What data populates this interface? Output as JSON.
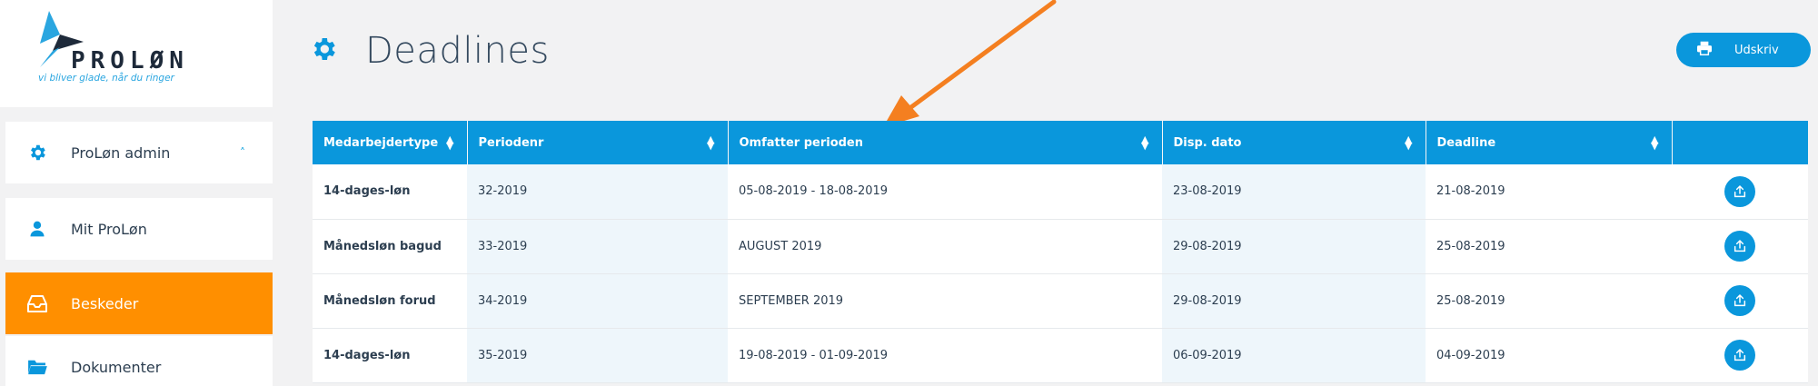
{
  "brand": {
    "name": "PROLØN",
    "tagline": "vi bliver glade, når du ringer",
    "accent": "#0a97dc",
    "highlight": "#ff8f00"
  },
  "sidebar": {
    "items": [
      {
        "label": "ProLøn admin",
        "icon": "gear-icon",
        "expanded": true
      },
      {
        "label": "Mit ProLøn",
        "icon": "user-icon"
      },
      {
        "label": "Beskeder",
        "icon": "inbox-icon",
        "active": true
      },
      {
        "label": "Dokumenter",
        "icon": "folder-icon"
      }
    ]
  },
  "header": {
    "title": "Deadlines",
    "icon": "gear-icon",
    "print_label": "Udskriv"
  },
  "table": {
    "columns": [
      "Medarbejdertype",
      "Periodenr",
      "Omfatter perioden",
      "Disp. dato",
      "Deadline",
      ""
    ],
    "rows": [
      [
        "14-dages-løn",
        "32-2019",
        "05-08-2019 - 18-08-2019",
        "23-08-2019",
        "21-08-2019"
      ],
      [
        "Månedsløn bagud",
        "33-2019",
        "AUGUST 2019",
        "29-08-2019",
        "25-08-2019"
      ],
      [
        "Månedsløn forud",
        "34-2019",
        "SEPTEMBER 2019",
        "29-08-2019",
        "25-08-2019"
      ],
      [
        "14-dages-løn",
        "35-2019",
        "19-08-2019 - 01-09-2019",
        "06-09-2019",
        "04-09-2019"
      ]
    ]
  }
}
